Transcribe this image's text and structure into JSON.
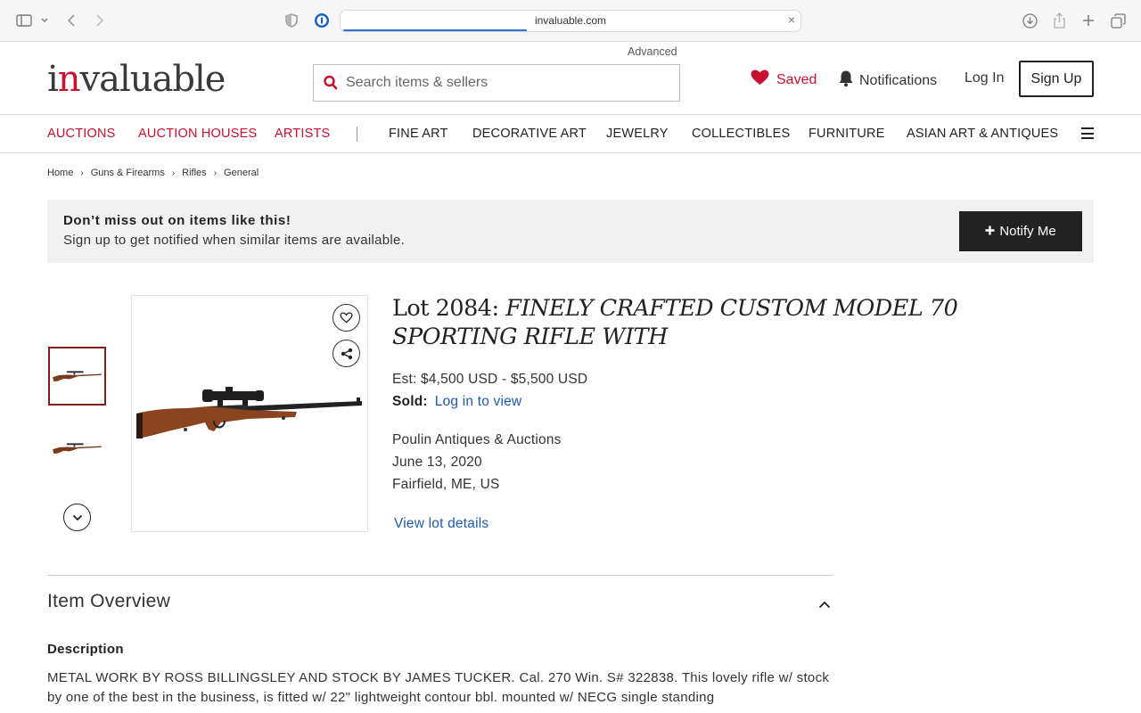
{
  "browser": {
    "url": "invaluable.com",
    "load_progress": 0.4
  },
  "header": {
    "logo_text_prefix": "i",
    "logo_text_accent": "n",
    "logo_text_suffix": "valuable",
    "advanced_label": "Advanced",
    "search_placeholder": "Search items & sellers",
    "saved_label": "Saved",
    "notifications_label": "Notifications",
    "login_label": "Log In",
    "signup_label": "Sign Up"
  },
  "nav": {
    "primary": [
      "AUCTIONS",
      "AUCTION HOUSES",
      "ARTISTS"
    ],
    "categories": [
      "FINE ART",
      "DECORATIVE ART",
      "JEWELRY",
      "COLLECTIBLES",
      "FURNITURE",
      "ASIAN ART & ANTIQUES"
    ]
  },
  "breadcrumb": [
    "Home",
    "Guns & Firearms",
    "Rifles",
    "General"
  ],
  "banner": {
    "heading": "Don’t miss out on items like this!",
    "subtext": "Sign up to get notified when similar items are available.",
    "button_label": "Notify Me"
  },
  "lot": {
    "lot_prefix": "Lot 2084:",
    "title": "FINELY CRAFTED CUSTOM MODEL 70 SPORTING RIFLE WITH",
    "estimate": "Est: $4,500 USD - $5,500 USD",
    "sold_label": "Sold:",
    "sold_link": "Log in to view",
    "auction_house": "Poulin Antiques & Auctions",
    "date": "June 13, 2020",
    "location": "Fairfield, ME, US",
    "view_details_label": "View lot details"
  },
  "overview": {
    "title": "Item Overview",
    "description_heading": "Description",
    "description_text": "METAL WORK BY ROSS BILLINGSLEY AND STOCK BY JAMES TUCKER. Cal. 270 Win. S# 322838. This lovely rifle w/ stock by one of the best in the business, is fitted w/ 22\" lightweight contour bbl. mounted w/ NECG single standing"
  },
  "colors": {
    "brand_red": "#c8102e",
    "link_blue": "#1f5aa8",
    "dark_button": "#222222",
    "banner_bg": "#f1f1f1"
  },
  "icons": [
    "sidebar-icon",
    "back-icon",
    "forward-icon",
    "shield-icon",
    "password-icon",
    "download-icon",
    "share-icon",
    "new-tab-icon",
    "tabs-icon",
    "search-icon",
    "heart-icon",
    "bell-icon",
    "menu-icon",
    "plus-icon",
    "chevron-down-icon",
    "chevron-up-icon"
  ]
}
